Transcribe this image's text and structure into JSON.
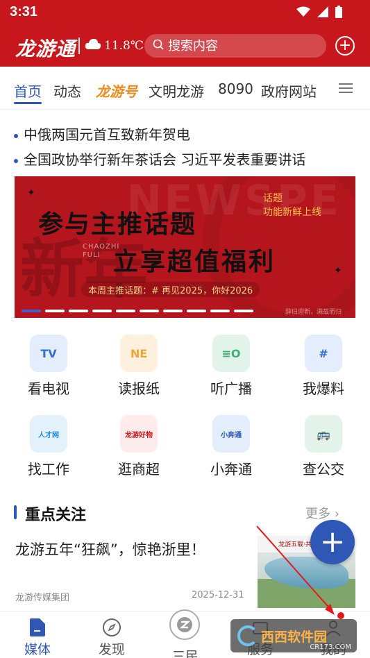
{
  "status_bar": {
    "time": "3:31"
  },
  "header": {
    "logo": "龙游通",
    "weather": "11.8℃",
    "search_placeholder": "搜索内容"
  },
  "tabs": [
    "首页",
    "动态",
    "龙游号",
    "文明龙游",
    "8090",
    "政府网站"
  ],
  "active_tab": "首页",
  "headlines": [
    "中俄两国元首互致新年贺电",
    "全国政协举行新年茶话会 习近平发表重要讲话"
  ],
  "banner": {
    "title_line1": "参与主推话题",
    "title_line2": "立享超值福利",
    "side_line1": "话题",
    "side_line2": "功能新鲜上线",
    "latin_1": "CHAOZHI",
    "latin_2": "FULI",
    "topic": "本周主推话题：# 再见2025，你好2026",
    "footer": "辞旧迎新，满载而归",
    "bg_text": "NEWSPE",
    "bg_char": "新年",
    "dots_total": 10,
    "active_dot": 1
  },
  "services": [
    {
      "label": "看电视",
      "icon": "tv-icon",
      "icon_text": "TV",
      "bg": "#e3edfb",
      "fg": "#2f6fd6"
    },
    {
      "label": "读报纸",
      "icon": "newspaper-icon",
      "icon_text": "NE",
      "bg": "#fdf0dc",
      "fg": "#f0a43a"
    },
    {
      "label": "听广播",
      "icon": "radio-icon",
      "icon_text": "≡O",
      "bg": "#e2f4ea",
      "fg": "#3fae74"
    },
    {
      "label": "我爆料",
      "icon": "hashtag-icon",
      "icon_text": "#",
      "bg": "#e3edfb",
      "fg": "#2f6fd6"
    },
    {
      "label": "找工作",
      "icon": "job-icon",
      "icon_text": "人才网",
      "bg": "#e3f1fb",
      "fg": "#1f8de0"
    },
    {
      "label": "逛商超",
      "icon": "mall-icon",
      "icon_text": "龙游好物",
      "bg": "#fdeceb",
      "fg": "#c8161d"
    },
    {
      "label": "小奔通",
      "icon": "xiaobentong-icon",
      "icon_text": "小奔通",
      "bg": "#e3edfb",
      "fg": "#2f57b5"
    },
    {
      "label": "查公交",
      "icon": "bus-icon",
      "icon_text": "🚌",
      "bg": "#e2f4ea",
      "fg": "#3fae74"
    }
  ],
  "section": {
    "title": "重点关注",
    "more": "更多",
    "article": {
      "title": "龙游五年“狂飙”，惊艳浙里！",
      "source": "龙游传媒集团",
      "date": "2025-12-31",
      "thumb_caption": "龙游五载·共赢"
    }
  },
  "bottom_nav": [
    {
      "label": "媒体",
      "active": true
    },
    {
      "label": "发现",
      "active": false
    },
    {
      "label": "三民",
      "active": false
    },
    {
      "label": "服务",
      "active": false
    },
    {
      "label": "我的",
      "active": false
    }
  ],
  "watermark": {
    "main": "西西软件园",
    "sub": "CR173.COM"
  },
  "colors": {
    "brand_red": "#c8161d",
    "accent_blue": "#2f57b5",
    "orange": "#ef8b1e"
  }
}
